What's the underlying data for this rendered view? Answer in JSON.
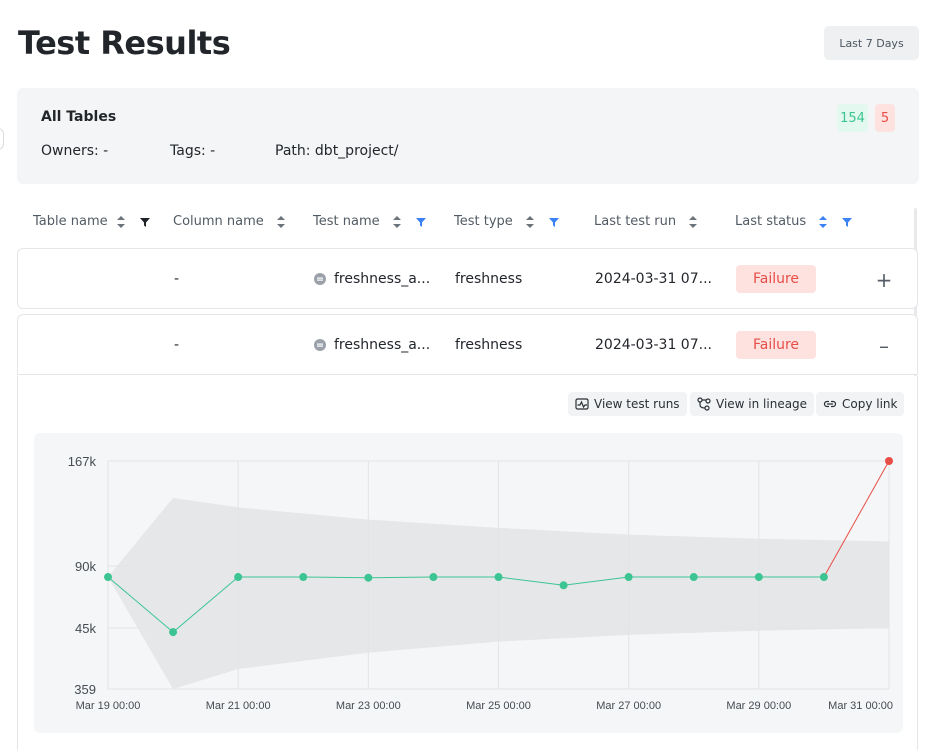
{
  "page": {
    "title": "Test Results",
    "date_range": "Last 7 Days"
  },
  "summary": {
    "title": "All Tables",
    "owners": "Owners: -",
    "tags": "Tags: -",
    "path": "Path: dbt_project/",
    "passed_count": "154",
    "failed_count": "5"
  },
  "table": {
    "columns": [
      {
        "label": "Table name",
        "filter": "active-dark"
      },
      {
        "label": "Column name",
        "filter": "none"
      },
      {
        "label": "Test name",
        "filter": "blue"
      },
      {
        "label": "Test type",
        "filter": "blue"
      },
      {
        "label": "Last test run",
        "filter": "none"
      },
      {
        "label": "Last status",
        "filter": "blue"
      }
    ],
    "rows": [
      {
        "table_name": "",
        "column_name": "-",
        "test_name": "freshness_a...",
        "test_type": "freshness",
        "last_run": "2024-03-31 07...",
        "status": "Failure",
        "toggle": "+"
      },
      {
        "table_name": "",
        "column_name": "-",
        "test_name": "freshness_a...",
        "test_type": "freshness",
        "last_run": "2024-03-31 07...",
        "status": "Failure",
        "toggle": "–"
      }
    ]
  },
  "detail": {
    "actions": {
      "view_runs": "View test runs",
      "view_lineage": "View in lineage",
      "copy_link": "Copy link"
    }
  },
  "colors": {
    "ok": "#3cc592",
    "fail": "#e84e48",
    "band": "#e3e4e6"
  },
  "chart_data": {
    "type": "line",
    "y_ticks": [
      {
        "label": "167k",
        "value": 167000
      },
      {
        "label": "90k",
        "value": 90000
      },
      {
        "label": "45k",
        "value": 45000
      },
      {
        "label": "359",
        "value": 359
      }
    ],
    "x_ticks": [
      "Mar 19 00:00",
      "Mar 21 00:00",
      "Mar 23 00:00",
      "Mar 25 00:00",
      "Mar 27 00:00",
      "Mar 29 00:00",
      "Mar 31 00:00"
    ],
    "x_tick_days": [
      19,
      21,
      23,
      25,
      27,
      29,
      31
    ],
    "x_range": [
      19,
      31
    ],
    "grid": true,
    "points": [
      {
        "day": 19,
        "value": 82000,
        "status": "ok"
      },
      {
        "day": 20,
        "value": 42000,
        "status": "ok"
      },
      {
        "day": 21,
        "value": 82000,
        "status": "ok"
      },
      {
        "day": 22,
        "value": 82000,
        "status": "ok"
      },
      {
        "day": 23,
        "value": 81500,
        "status": "ok"
      },
      {
        "day": 24,
        "value": 82000,
        "status": "ok"
      },
      {
        "day": 25,
        "value": 82000,
        "status": "ok"
      },
      {
        "day": 26,
        "value": 76000,
        "status": "ok"
      },
      {
        "day": 27,
        "value": 82000,
        "status": "ok"
      },
      {
        "day": 28,
        "value": 82000,
        "status": "ok"
      },
      {
        "day": 29,
        "value": 82000,
        "status": "ok"
      },
      {
        "day": 30,
        "value": 82000,
        "status": "ok"
      },
      {
        "day": 31,
        "value": 167000,
        "status": "fail"
      }
    ],
    "expected_band": [
      {
        "day": 19,
        "low": 82000,
        "high": 82000
      },
      {
        "day": 20,
        "low": 359,
        "high": 140000
      },
      {
        "day": 21,
        "low": 15000,
        "high": 133000
      },
      {
        "day": 23,
        "low": 27000,
        "high": 124000
      },
      {
        "day": 25,
        "low": 35000,
        "high": 118000
      },
      {
        "day": 27,
        "low": 40000,
        "high": 113000
      },
      {
        "day": 29,
        "low": 43000,
        "high": 110000
      },
      {
        "day": 31,
        "low": 45000,
        "high": 108000
      }
    ]
  }
}
